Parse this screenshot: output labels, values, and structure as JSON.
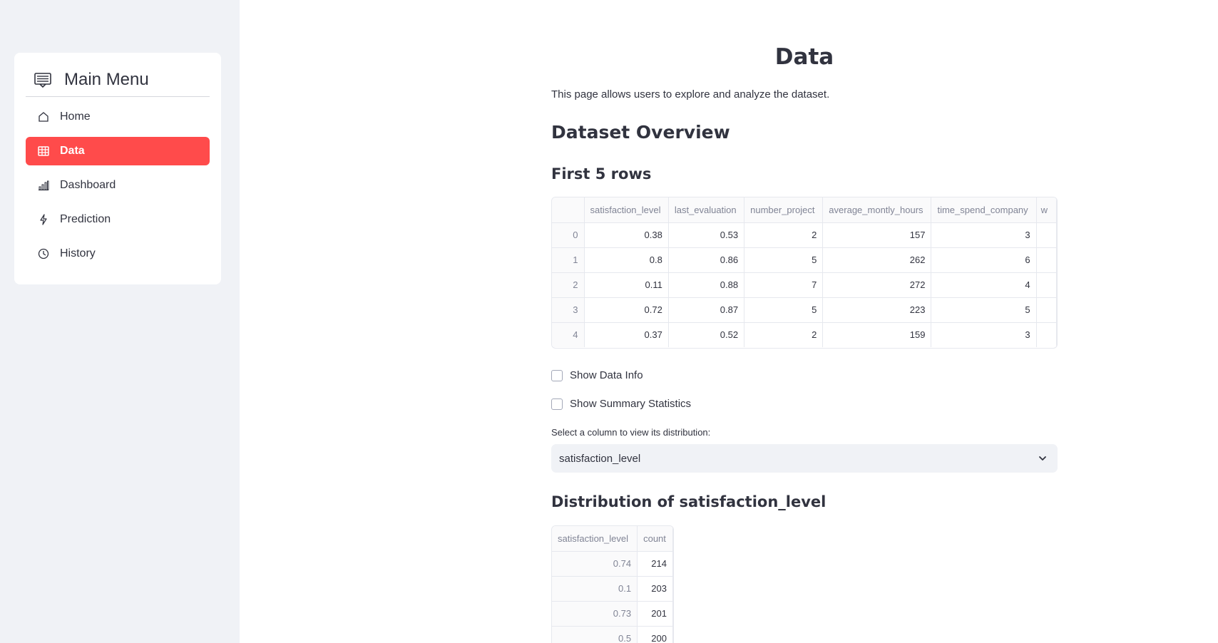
{
  "sidebar": {
    "title": "Main Menu",
    "title_icon": "menu-list-icon",
    "items": [
      {
        "label": "Home",
        "icon": "home-icon",
        "active": false
      },
      {
        "label": "Data",
        "icon": "table-icon",
        "active": true
      },
      {
        "label": "Dashboard",
        "icon": "bar-chart-icon",
        "active": false
      },
      {
        "label": "Prediction",
        "icon": "lightning-icon",
        "active": false
      },
      {
        "label": "History",
        "icon": "clock-icon",
        "active": false
      }
    ],
    "accent_color": "#ff4b4b"
  },
  "main": {
    "title": "Data",
    "description": "This page allows users to explore and analyze the dataset.",
    "overview_heading": "Dataset Overview",
    "first_rows_heading": "First 5 rows",
    "table": {
      "columns": [
        "",
        "satisfaction_level",
        "last_evaluation",
        "number_project",
        "average_montly_hours",
        "time_spend_company",
        "w"
      ],
      "rows": [
        [
          "0",
          "0.38",
          "0.53",
          "2",
          "157",
          "3",
          ""
        ],
        [
          "1",
          "0.8",
          "0.86",
          "5",
          "262",
          "6",
          ""
        ],
        [
          "2",
          "0.11",
          "0.88",
          "7",
          "272",
          "4",
          ""
        ],
        [
          "3",
          "0.72",
          "0.87",
          "5",
          "223",
          "5",
          ""
        ],
        [
          "4",
          "0.37",
          "0.52",
          "2",
          "159",
          "3",
          ""
        ]
      ]
    },
    "checkboxes": {
      "data_info": "Show Data Info",
      "summary_stats": "Show Summary Statistics"
    },
    "select": {
      "label": "Select a column to view its distribution:",
      "value": "satisfaction_level"
    },
    "distribution": {
      "heading": "Distribution of satisfaction_level",
      "columns": [
        "satisfaction_level",
        "count"
      ],
      "rows": [
        [
          "0.74",
          "214"
        ],
        [
          "0.1",
          "203"
        ],
        [
          "0.73",
          "201"
        ],
        [
          "0.5",
          "200"
        ]
      ]
    }
  }
}
